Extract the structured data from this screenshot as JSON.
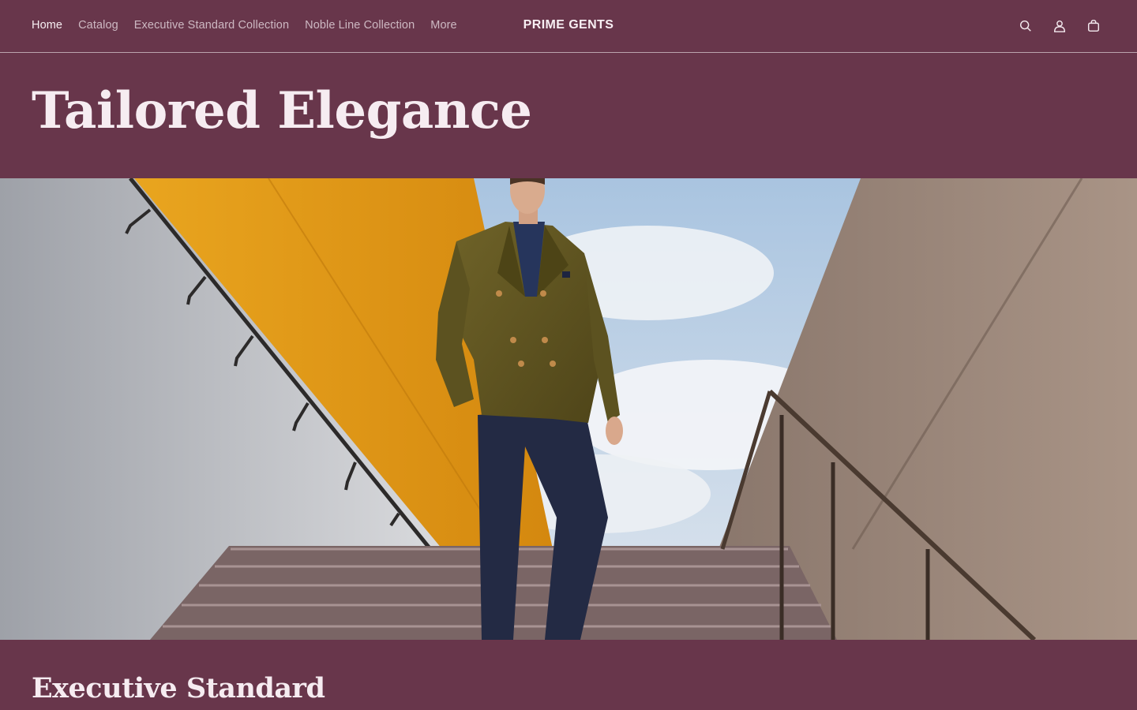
{
  "header": {
    "nav": [
      {
        "label": "Home",
        "active": true
      },
      {
        "label": "Catalog",
        "active": false
      },
      {
        "label": "Executive Standard Collection",
        "active": false
      },
      {
        "label": "Noble Line Collection",
        "active": false
      },
      {
        "label": "More",
        "active": false
      }
    ],
    "brand": "PRIME GENTS",
    "icons": [
      "search-icon",
      "account-icon",
      "cart-icon"
    ]
  },
  "hero": {
    "title": "Tailored Elegance",
    "image_description_icon": "hero-photo"
  },
  "section": {
    "title": "Executive Standard"
  },
  "colors": {
    "background": "#68364b",
    "text": "#f3e9ee"
  }
}
